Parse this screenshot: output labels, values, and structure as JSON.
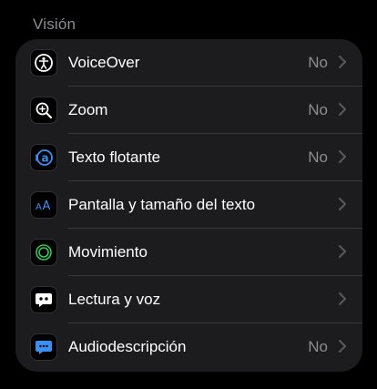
{
  "section": {
    "title": "Visión"
  },
  "rows": [
    {
      "label": "VoiceOver",
      "value": "No",
      "icon": "voiceover-icon"
    },
    {
      "label": "Zoom",
      "value": "No",
      "icon": "zoom-icon"
    },
    {
      "label": "Texto flotante",
      "value": "No",
      "icon": "hover-text-icon"
    },
    {
      "label": "Pantalla y tamaño del texto",
      "value": "",
      "icon": "text-size-icon"
    },
    {
      "label": "Movimiento",
      "value": "",
      "icon": "motion-icon"
    },
    {
      "label": "Lectura y voz",
      "value": "",
      "icon": "speech-icon"
    },
    {
      "label": "Audiodescripción",
      "value": "No",
      "icon": "audio-description-icon"
    }
  ],
  "colors": {
    "background": "#000000",
    "group": "#1c1c1e",
    "secondary_text": "#8d8d92",
    "accent_blue": "#3a8ff5",
    "accent_green": "#34c759"
  }
}
